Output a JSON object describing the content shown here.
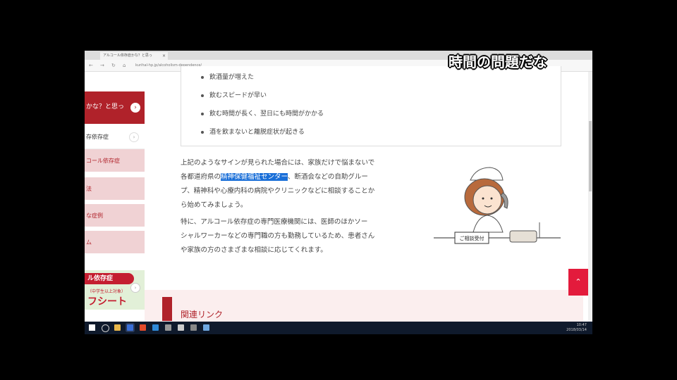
{
  "caption": "時間の問題だな",
  "browser": {
    "tab_title": "アルコール依存症かな？と思っ",
    "tab_close": "×",
    "url": "kurihal-hp.jp/alcoholism-dependence/"
  },
  "sidebar": {
    "top_label": "かな？と思っ",
    "top_arrow": "›",
    "items": [
      {
        "label": "存依存症"
      },
      {
        "label": "コール依存症"
      },
      {
        "label": "法"
      },
      {
        "label": "な症例"
      },
      {
        "label": "ム"
      }
    ],
    "item_arrow": "›",
    "banner_line1": "ル依存症",
    "banner_line2": "（中学生以上対象）",
    "banner_line3": "フシート",
    "banner_arrow": "›"
  },
  "checklist": [
    "飲酒量が増えた",
    "飲むスピードが早い",
    "飲む時間が長く、翌日にも時間がかかる",
    "酒を飲まないと離脱症状が起きる"
  ],
  "paragraph1": {
    "line1": "上記のようなサインが見られた場合には、家族だけで悩まないで",
    "line2_pre": "各都道府県の",
    "line2_highlight": "精神保健福祉センター",
    "line2_post": "、断酒会などの自助グルー",
    "line3": "プ、精神科や心療内科の病院やクリニックなどに相談することか",
    "line4": "ら始めてみましょう。"
  },
  "paragraph2": {
    "line1": "特に、アルコール依存症の専門医療機関には、医師のほかソー",
    "line2": "シャルワーカーなどの専門職の方も勤務しているため、患者さん",
    "line3": "や家族の方のさまざまな相談に応じてくれます。"
  },
  "illustration": {
    "desk_sign": "ご相談受付"
  },
  "related": {
    "title": "関連リンク"
  },
  "scroll_top": "⌃",
  "taskbar": {
    "time": "10:47",
    "date": "2018/03/14"
  },
  "colors": {
    "brand_red": "#b0222a",
    "highlight_blue": "#1a6fd8",
    "scroll_top_red": "#e31b3c"
  }
}
